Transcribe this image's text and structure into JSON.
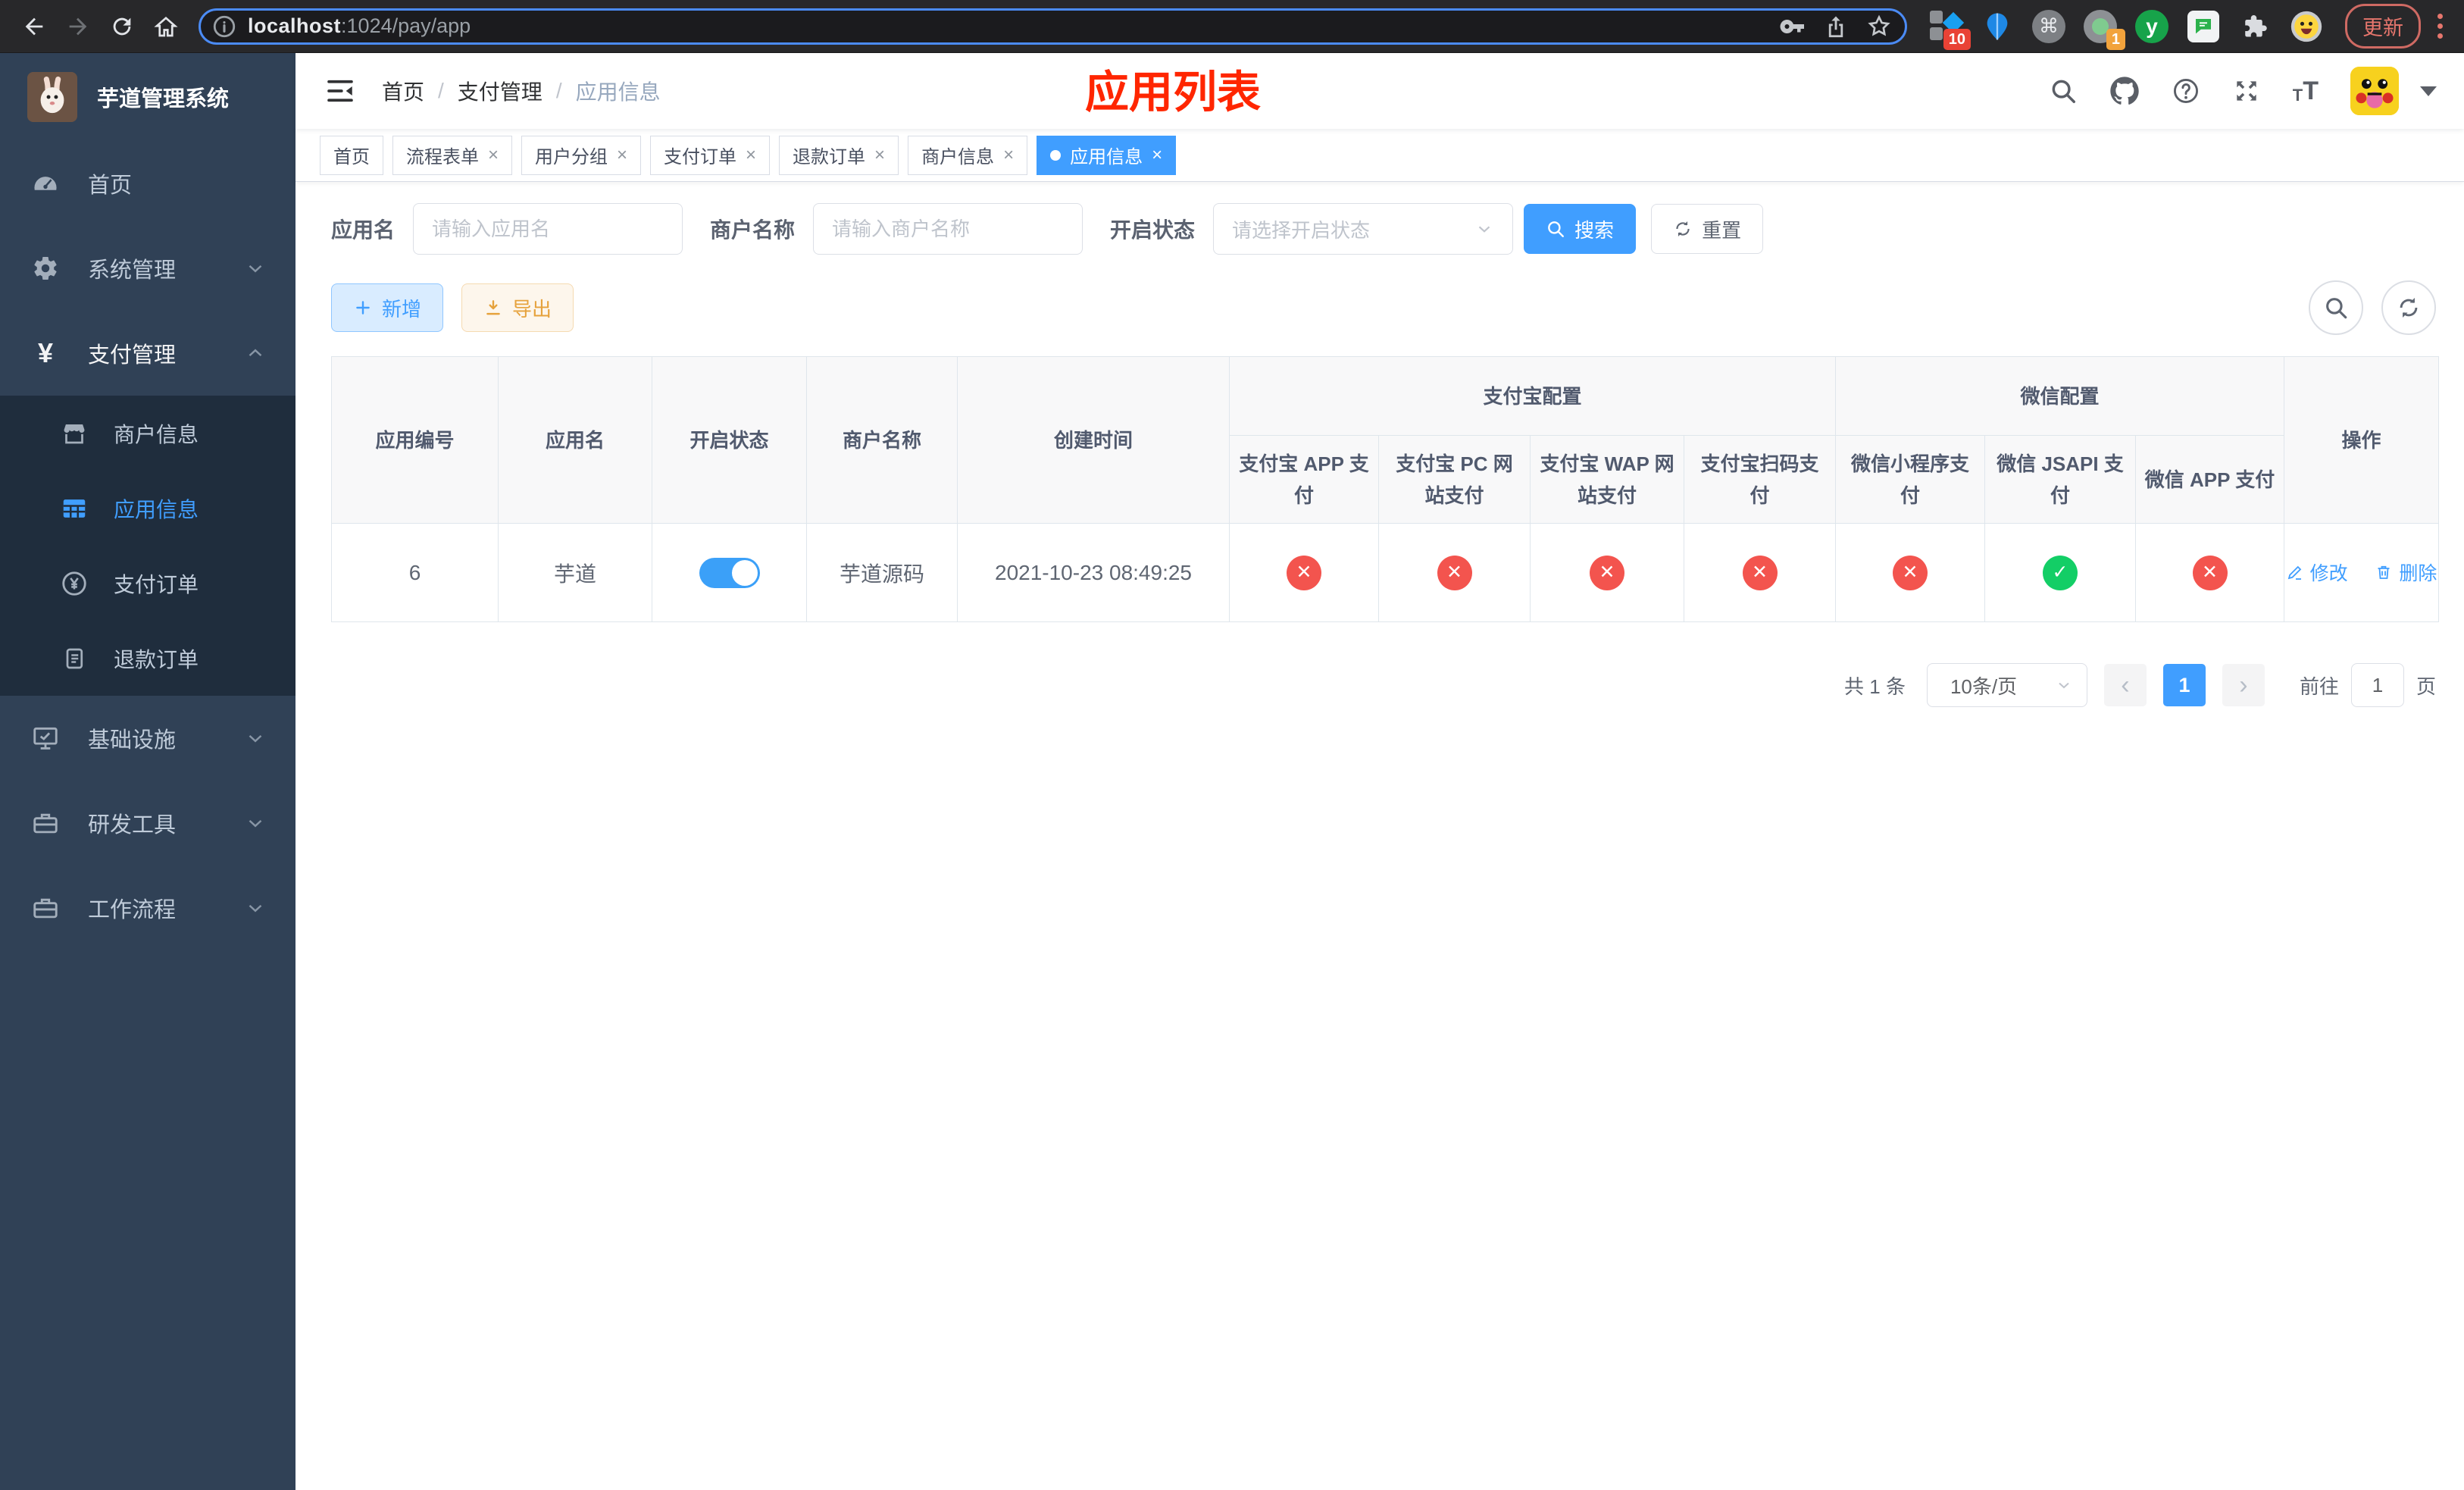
{
  "browser": {
    "url_host": "localhost",
    "url_rest": ":1024/pay/app",
    "ext_badge_red": "10",
    "ext_badge_orange": "1",
    "ext_cmd_glyph": "⌘",
    "ext_y_glyph": "y",
    "update_label": "更新"
  },
  "annotation": {
    "title": "应用列表"
  },
  "sidebar": {
    "app_title": "芋道管理系统",
    "yen_glyph": "¥",
    "items": {
      "home": "首页",
      "system": "系统管理",
      "payment": "支付管理",
      "merchant_info": "商户信息",
      "app_info": "应用信息",
      "pay_order": "支付订单",
      "refund_order": "退款订单",
      "infrastructure": "基础设施",
      "dev_tools": "研发工具",
      "workflow": "工作流程"
    }
  },
  "navbar": {
    "breadcrumb": [
      "首页",
      "支付管理",
      "应用信息"
    ],
    "separator": "/",
    "fontsize_small": "T",
    "fontsize_big": "T"
  },
  "tabs": {
    "close_glyph": "×",
    "items": [
      {
        "label": "首页"
      },
      {
        "label": "流程表单"
      },
      {
        "label": "用户分组"
      },
      {
        "label": "支付订单"
      },
      {
        "label": "退款订单"
      },
      {
        "label": "商户信息"
      },
      {
        "label": "应用信息"
      }
    ]
  },
  "search": {
    "app_name_label": "应用名",
    "app_name_placeholder": "请输入应用名",
    "merchant_label": "商户名称",
    "merchant_placeholder": "请输入商户名称",
    "status_label": "开启状态",
    "status_placeholder": "请选择开启状态",
    "search_button": "搜索",
    "reset_button": "重置"
  },
  "toolbar": {
    "add_label": "新增",
    "export_label": "导出"
  },
  "table": {
    "headers": {
      "app_id": "应用编号",
      "app_name": "应用名",
      "status": "开启状态",
      "merchant_name": "商户名称",
      "create_time": "创建时间",
      "alipay_group": "支付宝配置",
      "wechat_group": "微信配置",
      "actions": "操作",
      "channels": [
        "支付宝 APP 支付",
        "支付宝 PC 网站支付",
        "支付宝 WAP 网站支付",
        "支付宝扫码支付",
        "微信小程序支付",
        "微信 JSAPI 支付",
        "微信 APP 支付"
      ]
    },
    "row": {
      "app_id": "6",
      "app_name": "芋道",
      "status_enabled": true,
      "merchant_name": "芋道源码",
      "create_time": "2021-10-23 08:49:25",
      "channels": [
        {
          "name": "支付宝 APP 支付",
          "enabled": false,
          "glyph": "✕"
        },
        {
          "name": "支付宝 PC 网站支付",
          "enabled": false,
          "glyph": "✕"
        },
        {
          "name": "支付宝 WAP 网站支付",
          "enabled": false,
          "glyph": "✕"
        },
        {
          "name": "支付宝扫码支付",
          "enabled": false,
          "glyph": "✕"
        },
        {
          "name": "微信小程序支付",
          "enabled": false,
          "glyph": "✕"
        },
        {
          "name": "微信 JSAPI 支付",
          "enabled": true,
          "glyph": "✓"
        },
        {
          "name": "微信 APP 支付",
          "enabled": false,
          "glyph": "✕"
        }
      ],
      "edit_label": "修改",
      "delete_label": "删除"
    }
  },
  "pagination": {
    "total": "共 1 条",
    "page_size": "10条/页",
    "prev_glyph": "‹",
    "next_glyph": "›",
    "current_page": "1",
    "goto_label": "前往",
    "goto_value": "1",
    "goto_unit": "页"
  },
  "colors": {
    "accent_blue": "#409eff",
    "danger_red": "#f3544e",
    "success_green": "#13ce66",
    "warning_orange": "#e6a23c",
    "annotation_red": "#ff2600",
    "sidebar_bg": "#304156",
    "sidebar_sub_bg": "#1f2d3d"
  }
}
